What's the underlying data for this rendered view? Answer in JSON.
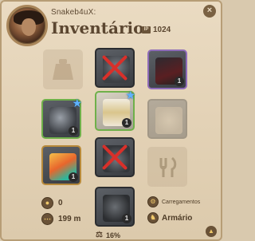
{
  "header": {
    "username": "Snakeb4uX:",
    "title": "Inventário",
    "item_power_icon": "IP",
    "item_power": "1024",
    "close_icon": "×"
  },
  "slots": {
    "bag": {
      "icon": "bag-icon",
      "state": "empty"
    },
    "head": {
      "icon": "helmet-icon",
      "state": "equipped-broken",
      "tier": ""
    },
    "cape": {
      "icon": "cape-icon",
      "state": "equipped",
      "tier": "1",
      "quality_color": "#8e6bb8"
    },
    "main_hand": {
      "icon": "gauntlet-weapon-icon",
      "state": "equipped",
      "tier": "1",
      "starred": true
    },
    "armor": {
      "icon": "robe-icon",
      "state": "equipped",
      "tier": "1",
      "starred": true
    },
    "off_hand": {
      "icon": "offhand-icon",
      "state": "faded"
    },
    "potion": {
      "icon": "potion-icon",
      "state": "equipped",
      "tier": "1"
    },
    "shoes": {
      "icon": "boots-icon",
      "state": "equipped-broken"
    },
    "food": {
      "icon": "fork-knife-icon",
      "state": "empty"
    },
    "mount": {
      "icon": "mount-icon",
      "state": "equipped",
      "tier": "1"
    }
  },
  "stats": {
    "silver": "0",
    "distance": "199 m",
    "load_percent": "16%"
  },
  "side_buttons": {
    "loadouts": "Carregamentos",
    "wardrobe": "Armário"
  },
  "colors": {
    "panel_bg": "#e3d2b6",
    "broken_mark": "#d8302a",
    "star": "#5fb3ff",
    "text": "#5b4630"
  }
}
